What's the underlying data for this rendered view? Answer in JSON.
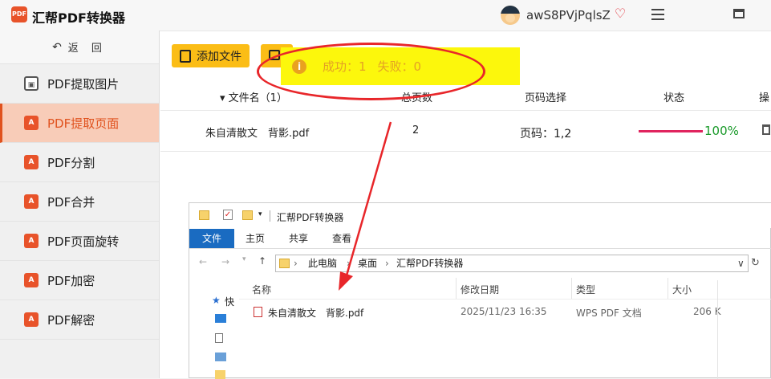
{
  "app": {
    "title": "汇帮PDF转换器",
    "logo_text": "PDF"
  },
  "user": {
    "name": "awS8PVjPqlsZ"
  },
  "sidebar": {
    "back": "返 回",
    "items": [
      {
        "label": "PDF提取图片",
        "active": false
      },
      {
        "label": "PDF提取页面",
        "active": true
      },
      {
        "label": "PDF分割",
        "active": false
      },
      {
        "label": "PDF合并",
        "active": false
      },
      {
        "label": "PDF页面旋转",
        "active": false
      },
      {
        "label": "PDF加密",
        "active": false
      },
      {
        "label": "PDF解密",
        "active": false
      }
    ]
  },
  "toolbar": {
    "add_file": "添加文件"
  },
  "toast": {
    "success": "成功：1",
    "fail": "失败：0"
  },
  "table": {
    "headers": {
      "name": "文件名（1）",
      "pages": "总页数",
      "page_select": "页码选择",
      "status": "状态",
      "ops": "操"
    },
    "row": {
      "file": "朱自清散文　背影.pdf",
      "pages": "2",
      "page_select": "页码：1,2",
      "percent": "100%",
      "progress": 1.0
    }
  },
  "explorer": {
    "title": "汇帮PDF转换器",
    "tabs": [
      "文件",
      "主页",
      "共享",
      "查看"
    ],
    "path": [
      "此电脑",
      "桌面",
      "汇帮PDF转换器"
    ],
    "nav": [
      "快"
    ],
    "columns": [
      "名称",
      "修改日期",
      "类型",
      "大小"
    ],
    "file": {
      "name": "朱自清散文　背影.pdf",
      "date": "2025/11/23 16:35",
      "type": "WPS PDF 文档",
      "size": "206 K"
    }
  },
  "colors": {
    "accent": "#fbbd16",
    "active": "#e0521e",
    "toast_bg": "#fcf70c",
    "highlight": "#e8262a",
    "progress": "#e0245e",
    "ok": "#1a9a2a"
  }
}
